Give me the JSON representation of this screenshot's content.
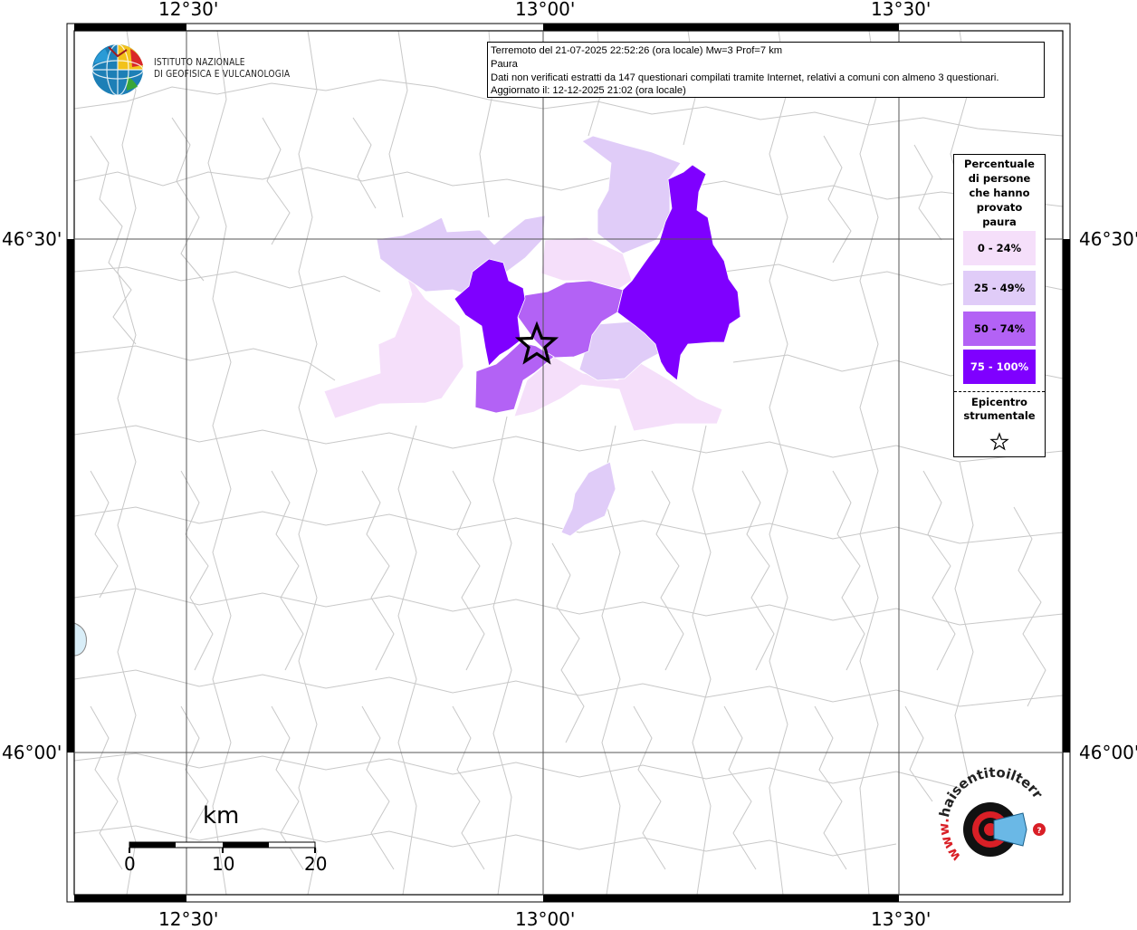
{
  "header": {
    "line1": "Terremoto del 21-07-2025 22:52:26 (ora locale) Mw=3 Prof=7 km",
    "line2": "Paura",
    "line3": "Dati non verificati estratti da 147 questionari compilati tramite Internet, relativi a comuni con almeno 3 questionari.",
    "line4": "Aggiornato il: 12-12-2025 21:02 (ora locale)"
  },
  "institute": {
    "name_line1": "ISTITUTO NAZIONALE",
    "name_line2": "DI GEOFISICA E VULCANOLOGIA"
  },
  "axes": {
    "lon_ticks": [
      "12°30'",
      "13°00'",
      "13°30'"
    ],
    "lat_ticks": [
      "46°30'",
      "46°00'"
    ]
  },
  "legend": {
    "title_lines": [
      "Percentuale",
      "di persone",
      "che hanno",
      "provato",
      "paura"
    ],
    "classes": [
      {
        "label": "0 - 24%",
        "color": "#f5dffa"
      },
      {
        "label": "25 - 49%",
        "color": "#e0ccf8"
      },
      {
        "label": "50 - 74%",
        "color": "#b362f5"
      },
      {
        "label": "75 - 100%",
        "color": "#7f00ff"
      }
    ],
    "epicenter_line1": "Epicentro",
    "epicenter_line2": "strumentale",
    "epicenter_icon": "star-outline-icon"
  },
  "scale": {
    "unit": "km",
    "labels": [
      "0",
      "10",
      "20"
    ]
  },
  "watermark": {
    "text": "haisentitoilterremoto.it",
    "prefix": "www.",
    "icon": "megaphone-icon"
  }
}
